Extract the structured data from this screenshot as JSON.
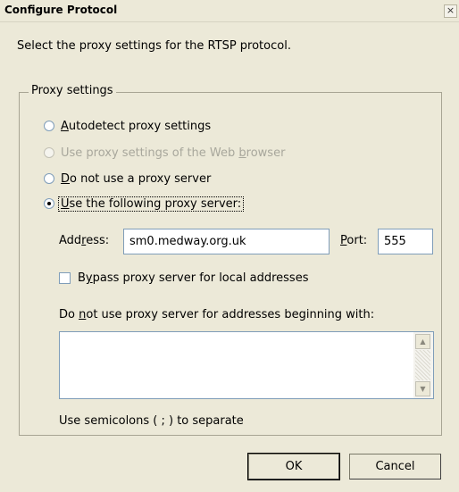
{
  "dialog": {
    "title": "Configure Protocol",
    "close_glyph": "×",
    "instruction": "Select the proxy settings for the RTSP protocol."
  },
  "proxy_settings": {
    "legend": "Proxy settings",
    "options": [
      {
        "label": "Autodetect proxy settings",
        "mnemonic": "A",
        "state": "unchecked"
      },
      {
        "label": "Use proxy settings of the Web browser",
        "mnemonic": "b",
        "state": "disabled"
      },
      {
        "label": "Do not use a proxy server",
        "mnemonic": "D",
        "state": "unchecked"
      },
      {
        "label": "Use the following proxy server:",
        "mnemonic": "U",
        "state": "checked"
      }
    ],
    "address": {
      "label": "Address:",
      "value": "sm0.medway.org.uk"
    },
    "port": {
      "label": "Port:",
      "value": "555"
    },
    "bypass": {
      "label": "Bypass proxy server for local addresses",
      "checked": false
    },
    "exceptions": {
      "label": "Do not use proxy server for addresses beginning with:",
      "value": "",
      "hint": "Use semicolons ( ; ) to separate"
    }
  },
  "buttons": {
    "ok": "OK",
    "cancel": "Cancel"
  },
  "icons": {
    "scroll_up": "scroll-up-icon",
    "scroll_down": "scroll-down-icon",
    "close": "close-icon"
  }
}
